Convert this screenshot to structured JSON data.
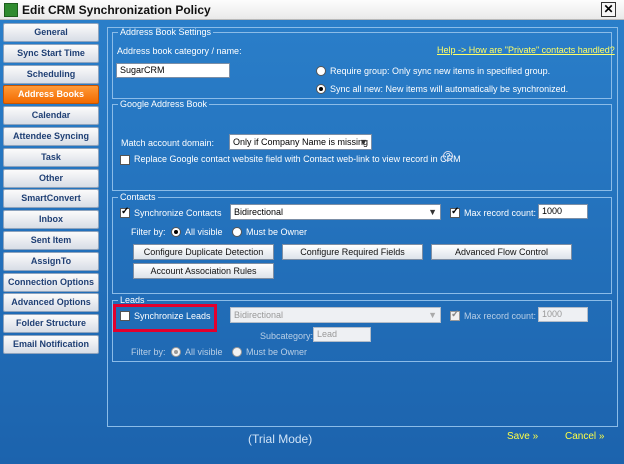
{
  "window": {
    "title": "Edit CRM Synchronization Policy",
    "close_glyph": "✕"
  },
  "sidebar": {
    "items": [
      {
        "label": "General"
      },
      {
        "label": "Sync Start Time"
      },
      {
        "label": "Scheduling"
      },
      {
        "label": "Address Books"
      },
      {
        "label": "Calendar"
      },
      {
        "label": "Attendee Syncing"
      },
      {
        "label": "Task"
      },
      {
        "label": "Other"
      },
      {
        "label": "SmartConvert"
      },
      {
        "label": "Inbox"
      },
      {
        "label": "Sent Item"
      },
      {
        "label": "AssignTo"
      },
      {
        "label": "Connection Options"
      },
      {
        "label": "Advanced Options"
      },
      {
        "label": "Folder Structure"
      },
      {
        "label": "Email Notification"
      }
    ],
    "active_index": 3
  },
  "address_book_settings": {
    "legend": "Address Book Settings",
    "category_label": "Address book category / name:",
    "category_value": "SugarCRM",
    "help_link": "Help -> How are \"Private\" contacts handled?",
    "require_group_label": "Require group: Only sync new items in specified group.",
    "sync_all_label": "Sync all new: New items will automatically be synchronized."
  },
  "google_address_book": {
    "legend": "Google Address Book",
    "match_domain_label": "Match account domain:",
    "match_domain_value": "Only if Company Name is missing",
    "replace_website_label": "Replace Google contact website field with Contact web-link to view record in CRM",
    "help_glyph": "?"
  },
  "contacts": {
    "legend": "Contacts",
    "sync_label": "Synchronize Contacts",
    "direction": "Bidirectional",
    "max_label": "Max record count:",
    "max_value": "1000",
    "filter_label": "Filter by:",
    "all_visible": "All visible",
    "must_be_owner": "Must be Owner",
    "btn_duplicate": "Configure Duplicate Detection",
    "btn_required": "Configure Required Fields",
    "btn_flow": "Advanced Flow Control",
    "btn_assoc": "Account Association Rules"
  },
  "leads": {
    "legend": "Leads",
    "sync_label": "Synchronize Leads",
    "direction": "Bidirectional",
    "max_label": "Max record count:",
    "max_value": "1000",
    "subcategory_label": "Subcategory:",
    "subcategory_value": "Lead",
    "filter_label": "Filter by:",
    "all_visible": "All visible",
    "must_be_owner": "Must be Owner"
  },
  "footer": {
    "mode": "(Trial Mode)",
    "save": "Save »",
    "cancel": "Cancel »"
  },
  "colors": {
    "accent": "#f26a00",
    "link": "#ffff66",
    "highlight": "#e3002d",
    "background": "#2c7bc4"
  }
}
